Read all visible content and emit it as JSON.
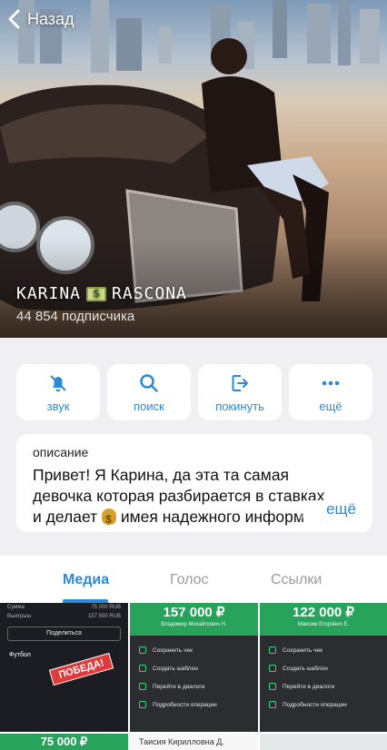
{
  "nav": {
    "back_label": "Назад"
  },
  "channel": {
    "name": "KARINA 💵 RASCONA",
    "name_parts": [
      "KARINA",
      "RASCONA"
    ],
    "subscribers": "44 854 подписчика"
  },
  "actions": [
    {
      "label": "звук",
      "icon": "bell-icon"
    },
    {
      "label": "поиск",
      "icon": "search-icon"
    },
    {
      "label": "покинуть",
      "icon": "leave-icon"
    },
    {
      "label": "ещё",
      "icon": "more-dots-icon"
    }
  ],
  "description": {
    "label": "описание",
    "line1": "Привет! Я Карина, да эта та самая",
    "line2": "девочка которая разбирается в ставках",
    "line3_before": "и делает",
    "line3_after": "имея надежного информ",
    "more_label": "ещё"
  },
  "tabs": [
    {
      "label": "Медиа",
      "active": true
    },
    {
      "label": "Голос",
      "active": false
    },
    {
      "label": "Ссылки",
      "active": false
    }
  ],
  "media": {
    "cell1": {
      "rows": [
        {
          "k": "Сумма",
          "v": "75 000 RUB"
        },
        {
          "k": "Выигрыш",
          "v": "157 500 RUB"
        }
      ],
      "share_label": "Поделиться",
      "sport_label": "Футбол",
      "badge": "ПОБЕДА!"
    },
    "cell2": {
      "amount": "157 000 ₽",
      "name": "Владимир Михайлович Н.",
      "menu": [
        "Сохранить чек",
        "Создать шаблон",
        "Перейти в диалоги",
        "Подробности операции"
      ]
    },
    "cell3": {
      "amount": "122 000 ₽",
      "name": "Максим Егорович Е.",
      "menu": [
        "Сохранить чек",
        "Создать шаблон",
        "Перейти в диалоги",
        "Подробности операции"
      ]
    },
    "cell4": {
      "amount": "75 000 ₽"
    },
    "cell5": {
      "name": "Таисия Кирилловна Д."
    }
  },
  "colors": {
    "accent": "#2a8ad8",
    "sber_green": "#27a35b",
    "bg": "#f0f0f3"
  }
}
